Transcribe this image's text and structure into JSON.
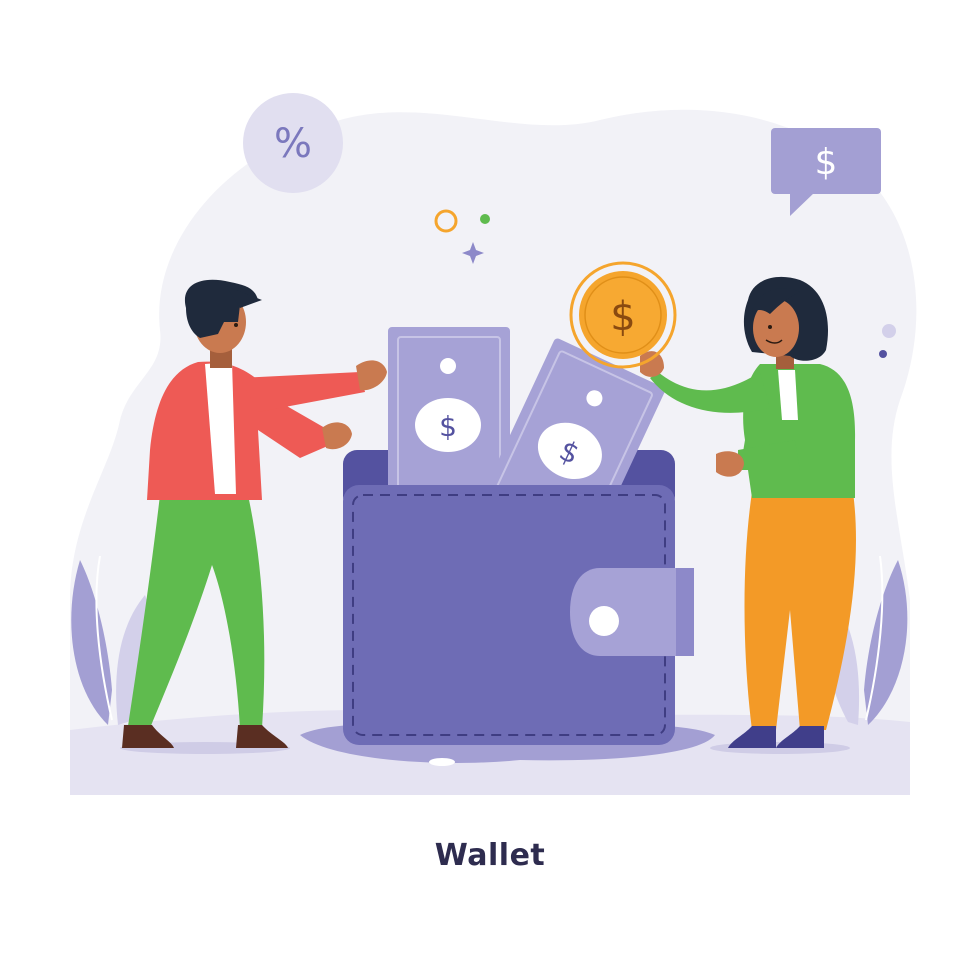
{
  "caption": "Wallet",
  "icons": {
    "percent_bubble": "%",
    "dollar_speech": "$",
    "coin": "$",
    "banknote_front": "$",
    "banknote_back": "$"
  },
  "colors": {
    "wallet": "#6e6cb5",
    "wallet_dark": "#5452a0",
    "banknote": "#a6a2d6",
    "coin": "#f5a52d",
    "lavender": "#a39fd3",
    "blob": "#f2f2f7",
    "ground": "#e5e3f2",
    "man_jacket": "#ee5a55",
    "man_pants": "#5fbb4e",
    "woman_top": "#5fbb4e",
    "woman_pants": "#f39a27",
    "hair": "#1f2a3c",
    "skin": "#c97a50"
  }
}
